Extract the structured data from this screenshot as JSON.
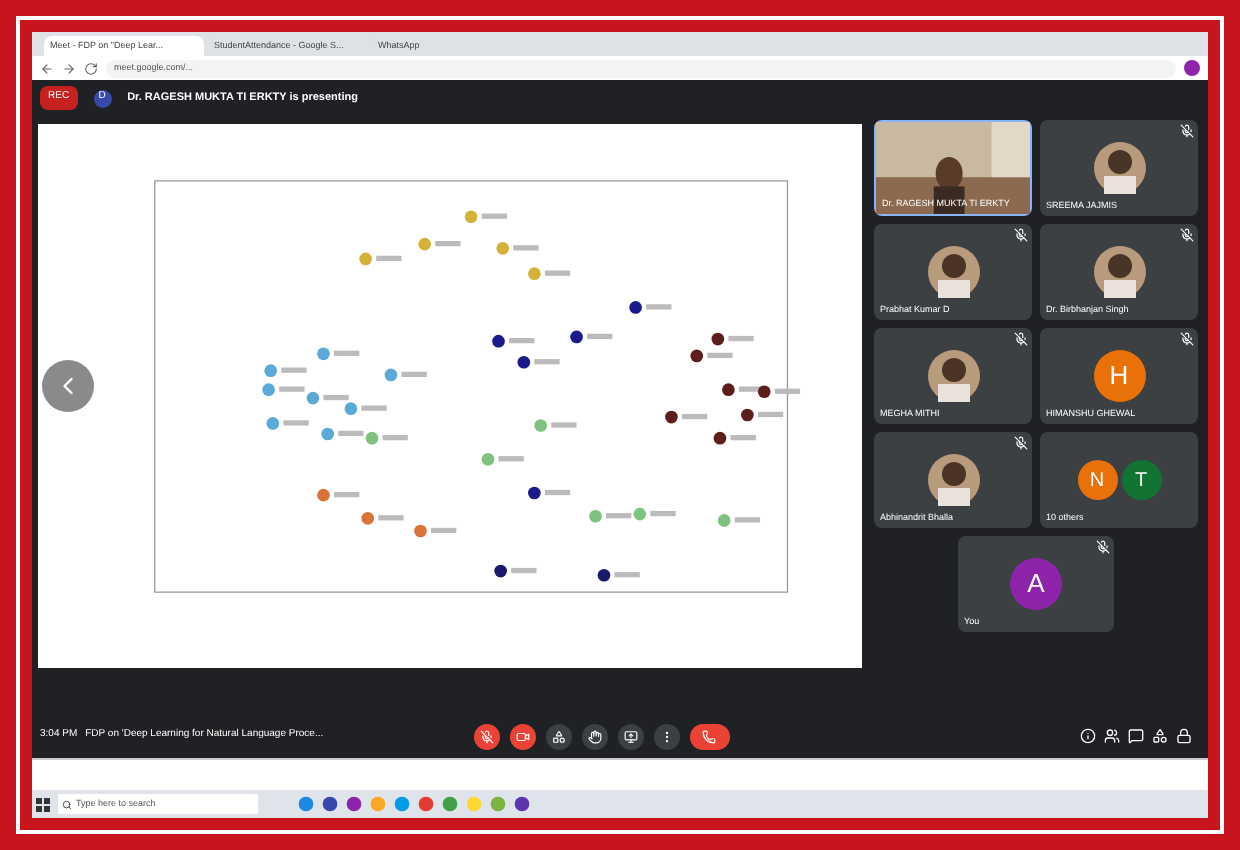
{
  "browser": {
    "tabs": [
      {
        "label": "Meet - FDP on \"Deep Lear...",
        "selected": true
      },
      {
        "label": "StudentAttendance - Google S...",
        "selected": false
      },
      {
        "label": "WhatsApp",
        "selected": false
      }
    ],
    "address": "meet.google.com/..."
  },
  "meet": {
    "rec_label": "REC",
    "presenter_initial": "D",
    "presenter_text": "Dr. RAGESH MUKTA TI ERKTY is presenting",
    "time": "3:04 PM",
    "title": "FDP on 'Deep Learning for Natural Language Proce..."
  },
  "participants": [
    {
      "name": "Dr. RAGESH MUKTA TI ERKTY",
      "kind": "video",
      "muted": false
    },
    {
      "name": "SREEMA JAJMIS",
      "muted": true
    },
    {
      "name": "Prabhat Kumar D",
      "muted": true
    },
    {
      "name": "Dr. Birbhanjan Singh",
      "muted": true
    },
    {
      "name": "MEGHA MITHI",
      "muted": true
    },
    {
      "name": "HIMANSHU GHEWAL",
      "kind": "initial",
      "initial": "H",
      "color": "#e8710a",
      "muted": true
    },
    {
      "name": "Abhinandrit Bhalla",
      "muted": true
    },
    {
      "name": "10 others",
      "kind": "group",
      "initials": [
        {
          "initial": "N",
          "color": "#e8710a"
        },
        {
          "initial": "T",
          "color": "#137333"
        }
      ],
      "muted": false
    },
    {
      "name": "You",
      "kind": "initial",
      "initial": "A",
      "color": "#8e24aa",
      "muted": true
    }
  ],
  "taskbar": {
    "search_placeholder": "Type here to search"
  }
}
